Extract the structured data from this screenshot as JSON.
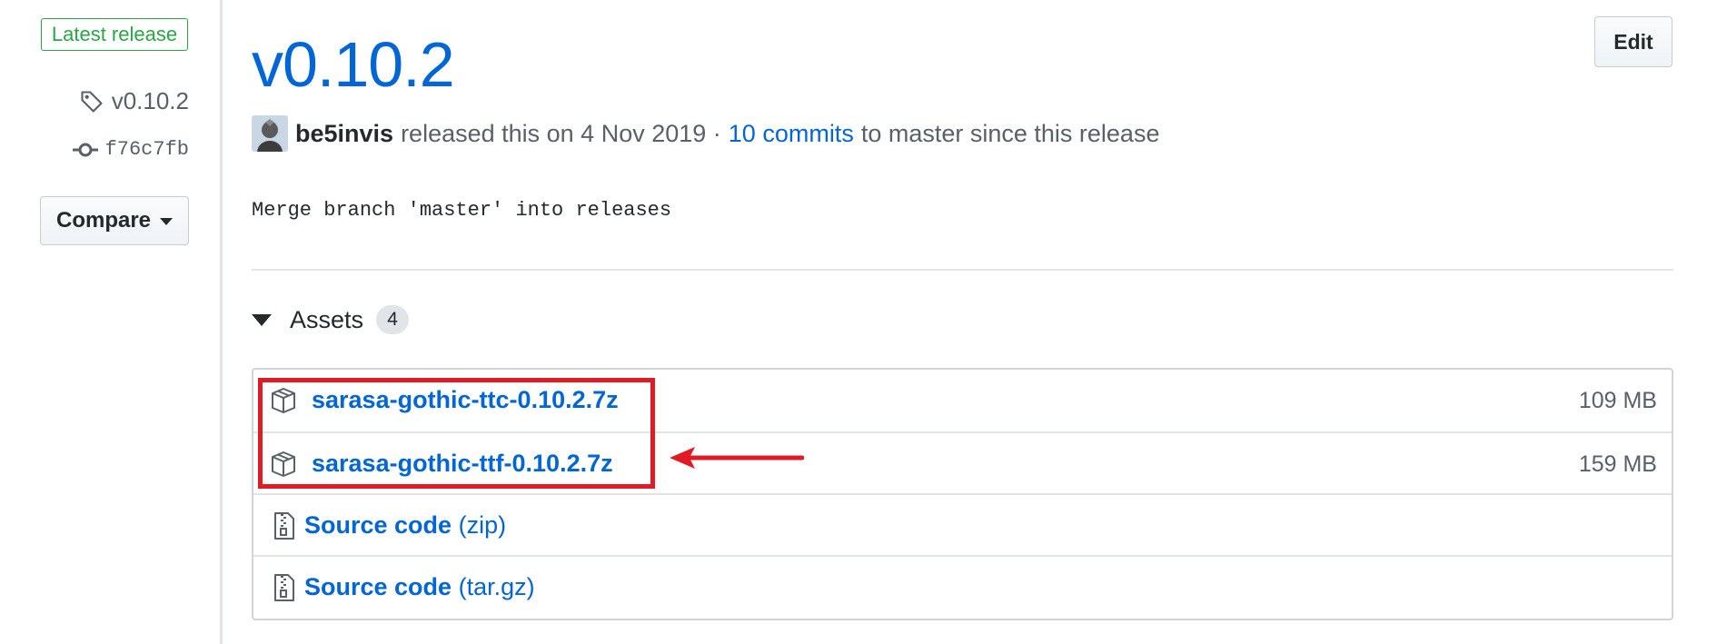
{
  "sidebar": {
    "latest_badge": "Latest release",
    "tag": "v0.10.2",
    "commit": "f76c7fb",
    "compare_label": "Compare"
  },
  "release": {
    "title": "v0.10.2",
    "edit_label": "Edit",
    "author": "be5invis",
    "released_text": "released this on 4 Nov 2019 ·",
    "commits_link": "10 commits",
    "since_text": "to master since this release",
    "body": "Merge branch 'master' into releases"
  },
  "assets": {
    "heading": "Assets",
    "count": "4",
    "items": [
      {
        "name": "sarasa-gothic-ttc-0.10.2.7z",
        "size": "109 MB",
        "icon": "package-icon"
      },
      {
        "name": "sarasa-gothic-ttf-0.10.2.7z",
        "size": "159 MB",
        "icon": "package-icon"
      },
      {
        "name": "Source code",
        "suffix": "(zip)",
        "icon": "file-zip-icon"
      },
      {
        "name": "Source code",
        "suffix": "(tar.gz)",
        "icon": "file-zip-icon"
      }
    ]
  },
  "annotation": {
    "highlight_color": "#e01b24"
  },
  "colors": {
    "link": "#0366d6",
    "badge_green": "#28a745",
    "muted": "#586069"
  }
}
